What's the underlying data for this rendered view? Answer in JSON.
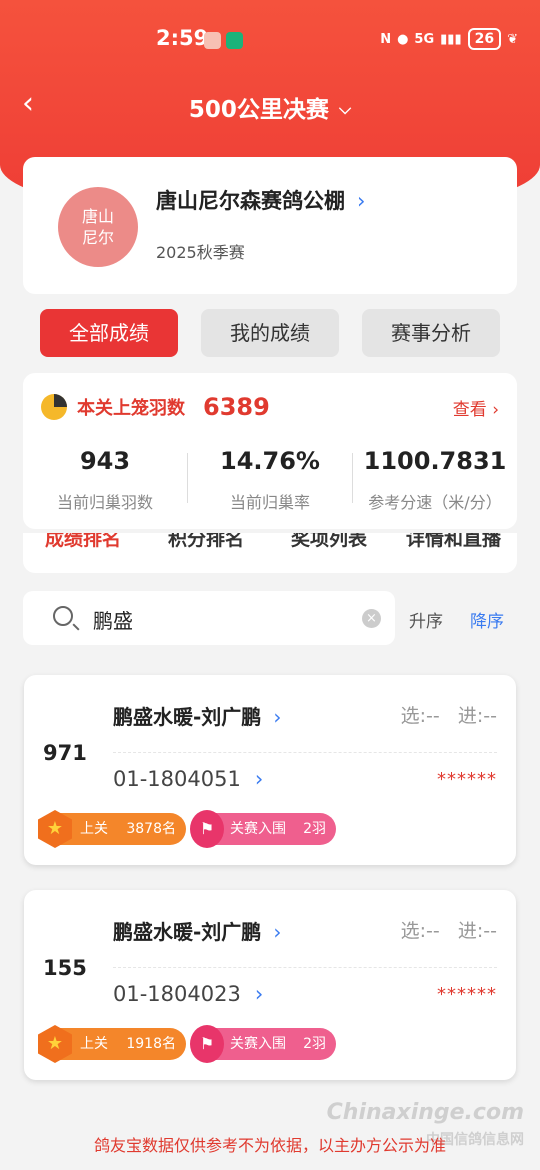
{
  "status_bar": {
    "time": "2:59",
    "network": "5G",
    "battery": "26"
  },
  "nav": {
    "title": "500公里决赛"
  },
  "club": {
    "logo_text": "唐山尼尔",
    "name": "唐山尼尔森赛鸽公棚",
    "season": "2025秋季赛"
  },
  "tabs": [
    "全部成绩",
    "我的成绩",
    "赛事分析"
  ],
  "stats": {
    "label": "本关上笼羽数",
    "total": "6389",
    "view_label": "查看",
    "items": [
      {
        "value": "943",
        "label": "当前归巢羽数"
      },
      {
        "value": "14.76%",
        "label": "当前归巢率"
      },
      {
        "value": "1100.7831",
        "label": "参考分速（米/分）"
      }
    ]
  },
  "sub_tabs": [
    "成绩排名",
    "积分排名",
    "奖项列表",
    "详情和直播"
  ],
  "search": {
    "value": "鹏盛"
  },
  "sort": {
    "asc": "升序",
    "desc": "降序"
  },
  "results": [
    {
      "rank": "971",
      "name": "鹏盛水暖-刘广鹏",
      "select": "选:--",
      "enter": "进:--",
      "ring": "01-1804051",
      "speed": "******",
      "badge1": {
        "label": "上关",
        "value": "3878名"
      },
      "badge2": {
        "label": "关赛入围",
        "value": "2羽"
      }
    },
    {
      "rank": "155",
      "name": "鹏盛水暖-刘广鹏",
      "select": "选:--",
      "enter": "进:--",
      "ring": "01-1804023",
      "speed": "******",
      "badge1": {
        "label": "上关",
        "value": "1918名"
      },
      "badge2": {
        "label": "关赛入围",
        "value": "2羽"
      }
    }
  ],
  "footer": {
    "disclaimer": "鸽友宝数据仅供参考不为依据，以主办方公示为准"
  },
  "watermark": {
    "line1": "Chinaxinge.com",
    "line2": "中国信鸽信息网"
  },
  "colors": {
    "primary": "#e93535",
    "accent_blue": "#3a7bf0"
  }
}
